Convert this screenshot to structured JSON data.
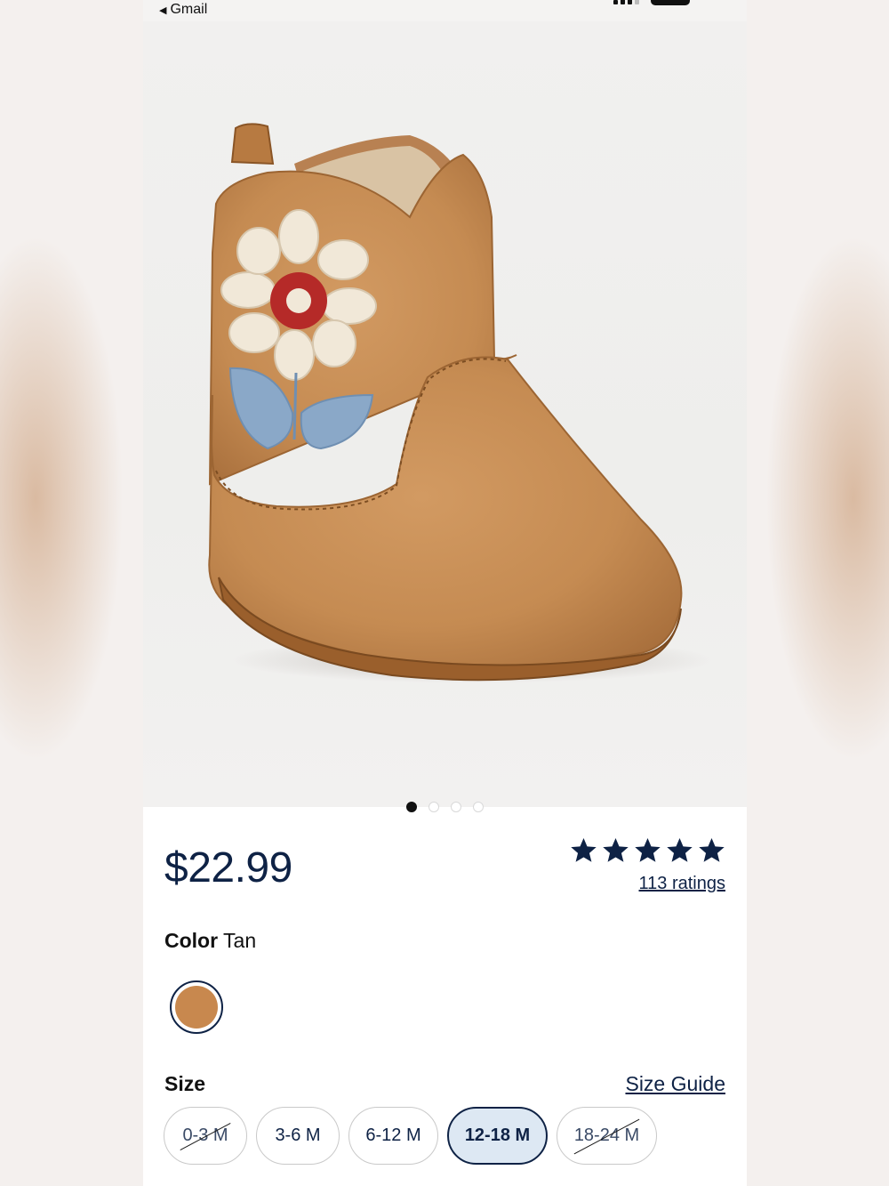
{
  "status_bar": {
    "back_label": "Gmail"
  },
  "product": {
    "image_alt": "Tan baby cowboy boot with embroidered flower",
    "carousel": {
      "count": 4,
      "active_index": 0
    },
    "price": "$22.99",
    "rating": {
      "stars": 5,
      "ratings_label": "113 ratings"
    },
    "color": {
      "label": "Color",
      "value": "Tan",
      "swatch_hex": "#c8884e"
    },
    "size": {
      "label": "Size",
      "guide_label": "Size Guide",
      "options": [
        {
          "label": "0-3 M",
          "available": false,
          "selected": false
        },
        {
          "label": "3-6 M",
          "available": true,
          "selected": false
        },
        {
          "label": "6-12 M",
          "available": true,
          "selected": false
        },
        {
          "label": "12-18 M",
          "available": true,
          "selected": true
        },
        {
          "label": "18-24 M",
          "available": false,
          "selected": false
        }
      ]
    }
  },
  "colors": {
    "navy": "#0e2245",
    "boot_tan": "#c8884e"
  }
}
